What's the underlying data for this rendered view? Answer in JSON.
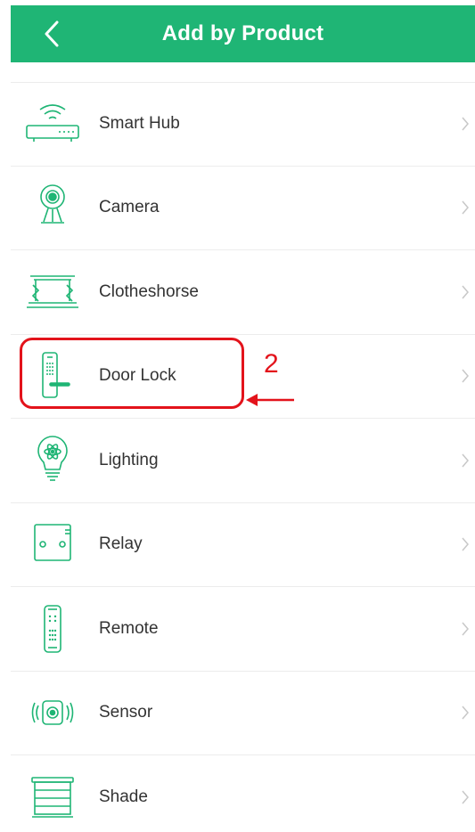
{
  "header": {
    "title": "Add by Product",
    "back_icon": "chevron-left-icon",
    "background": "#1FB575"
  },
  "products": [
    {
      "label": "Smart Hub",
      "icon": "router-icon"
    },
    {
      "label": "Camera",
      "icon": "camera-icon"
    },
    {
      "label": "Clotheshorse",
      "icon": "clotheshorse-icon"
    },
    {
      "label": "Door Lock",
      "icon": "door-lock-icon"
    },
    {
      "label": "Lighting",
      "icon": "lightbulb-icon"
    },
    {
      "label": "Relay",
      "icon": "relay-icon"
    },
    {
      "label": "Remote",
      "icon": "remote-icon"
    },
    {
      "label": "Sensor",
      "icon": "sensor-icon"
    },
    {
      "label": "Shade",
      "icon": "shade-icon"
    }
  ],
  "annotation": {
    "number": "2",
    "color": "#E3131B",
    "target": "Door Lock"
  },
  "colors": {
    "accent": "#1FB575",
    "text": "#333333",
    "chevron": "#c8c8c8"
  }
}
